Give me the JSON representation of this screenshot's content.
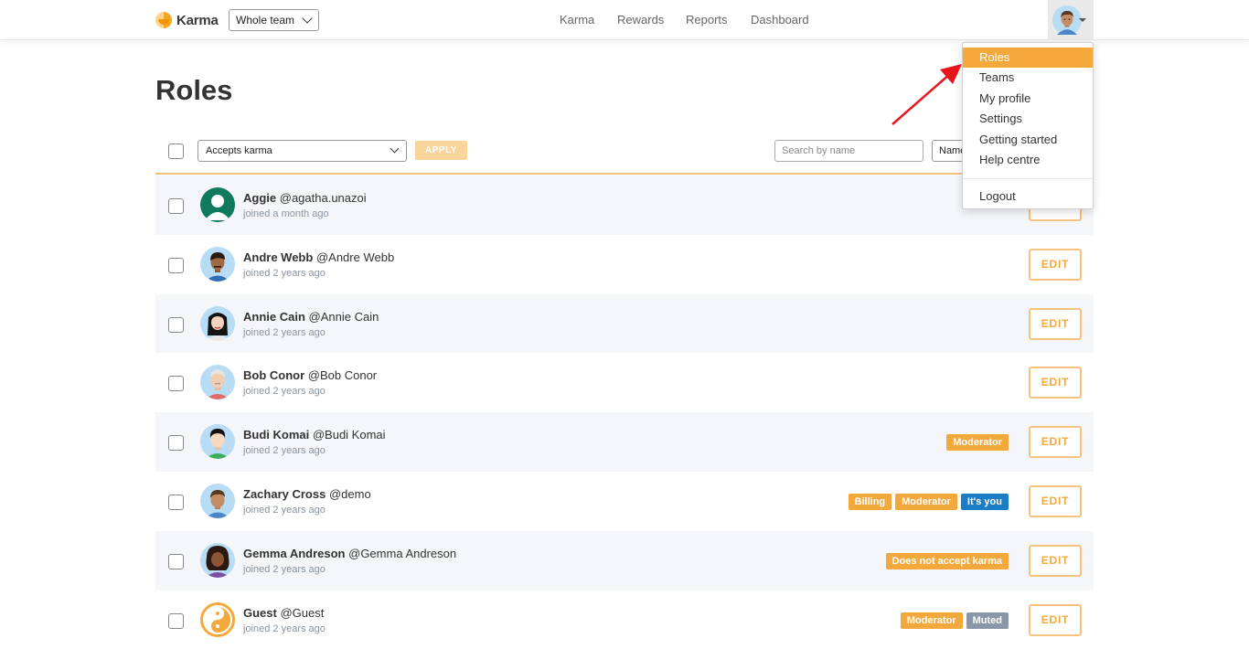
{
  "header": {
    "logo_text": "Karma",
    "team_select_value": "Whole team",
    "nav": [
      "Karma",
      "Rewards",
      "Reports",
      "Dashboard"
    ]
  },
  "user_menu": {
    "items": [
      "Roles",
      "Teams",
      "My profile",
      "Settings",
      "Getting started",
      "Help centre"
    ],
    "logout": "Logout",
    "active": "Roles"
  },
  "page": {
    "title": "Roles"
  },
  "toolbar": {
    "filter_value": "Accepts karma",
    "apply_label": "APPLY",
    "search_placeholder": "Search by name",
    "sort_value": "Name"
  },
  "users": [
    {
      "name": "Aggie",
      "handle": "@agatha.unazoi",
      "joined": "joined a month ago",
      "badges": [],
      "edit": "EDIT",
      "avatar": "default-avatar"
    },
    {
      "name": "Andre Webb",
      "handle": "@Andre Webb",
      "joined": "joined 2 years ago",
      "badges": [],
      "edit": "EDIT",
      "avatar": "man-avatar"
    },
    {
      "name": "Annie Cain",
      "handle": "@Annie Cain",
      "joined": "joined 2 years ago",
      "badges": [],
      "edit": "EDIT",
      "avatar": "woman-avatar"
    },
    {
      "name": "Bob Conor",
      "handle": "@Bob Conor",
      "joined": "joined 2 years ago",
      "badges": [],
      "edit": "EDIT",
      "avatar": "man-avatar"
    },
    {
      "name": "Budi Komai",
      "handle": "@Budi Komai",
      "joined": "joined 2 years ago",
      "badges": [
        {
          "label": "Moderator",
          "color": "#f3a83b"
        }
      ],
      "edit": "EDIT",
      "avatar": "man-avatar"
    },
    {
      "name": "Zachary Cross",
      "handle": "@demo",
      "joined": "joined 2 years ago",
      "badges": [
        {
          "label": "Billing",
          "color": "#f3a83b"
        },
        {
          "label": "Moderator",
          "color": "#f3a83b"
        },
        {
          "label": "It's you",
          "color": "#1b7ec4"
        }
      ],
      "edit": "EDIT",
      "avatar": "man-avatar"
    },
    {
      "name": "Gemma Andreson",
      "handle": "@Gemma Andreson",
      "joined": "joined 2 years ago",
      "badges": [
        {
          "label": "Does not accept karma",
          "color": "#f3a83b"
        }
      ],
      "edit": "EDIT",
      "avatar": "woman-avatar"
    },
    {
      "name": "Guest",
      "handle": "@Guest",
      "joined": "joined 2 years ago",
      "badges": [
        {
          "label": "Moderator",
          "color": "#f3a83b"
        },
        {
          "label": "Muted",
          "color": "#8a97a8"
        }
      ],
      "edit": "EDIT",
      "avatar": "guest-avatar"
    }
  ],
  "colors": {
    "accent": "#f5a93a",
    "badge_orange": "#f3a83b",
    "badge_blue": "#1b7ec4",
    "badge_gray": "#8a97a8",
    "arrow": "#e8141b"
  }
}
